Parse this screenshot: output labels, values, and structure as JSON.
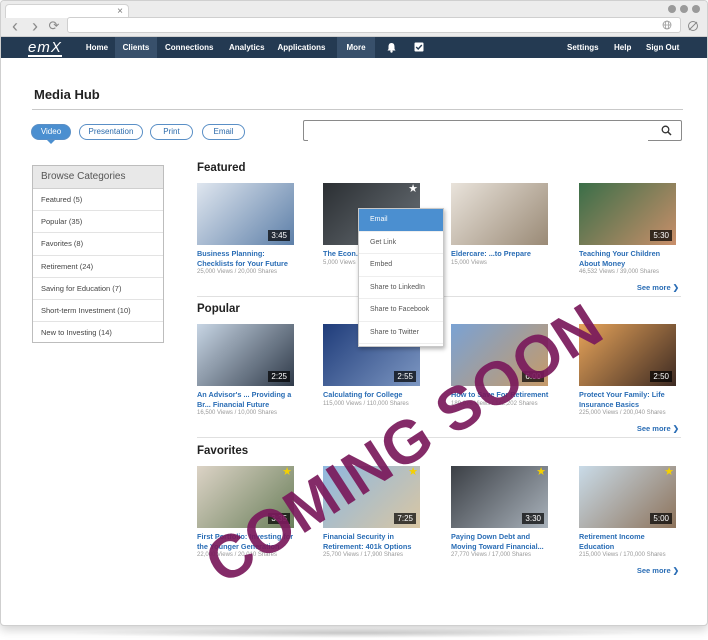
{
  "browser": {
    "tab_close": "×",
    "back_icon": "‹",
    "forward_icon": "›",
    "reload_icon": "⟳"
  },
  "topnav": {
    "logo": "emX",
    "items": [
      {
        "label": "Home",
        "active": false
      },
      {
        "label": "Clients",
        "active": true
      },
      {
        "label": "Connections",
        "active": false
      },
      {
        "label": "Analytics",
        "active": false
      },
      {
        "label": "Applications ▾",
        "active": false
      },
      {
        "label": "More ▾",
        "active": true
      }
    ],
    "right_items": [
      "Settings",
      "Help",
      "Sign Out"
    ],
    "icons": [
      "bell-icon",
      "checkbox-icon"
    ]
  },
  "page": {
    "title": "Media Hub",
    "filters": [
      "Video",
      "Presentation",
      "Print",
      "Email"
    ],
    "search_placeholder": ""
  },
  "sidebar": {
    "heading": "Browse Categories",
    "items": [
      "Featured (5)",
      "Popular (35)",
      "Favorites (8)",
      "Retirement (24)",
      "Saving for Education (7)",
      "Short-term Investment (10)",
      "New to Investing (14)"
    ]
  },
  "sections": [
    {
      "title": "Featured",
      "see_more": "See more ❯",
      "cards": [
        {
          "title": "Business Planning: Checklists for Your Future",
          "stats": "25,000 Views / 20,000 Shares",
          "duration": "3:45",
          "star": false,
          "colors": [
            "#dfe6ef",
            "#5d7fa8"
          ]
        },
        {
          "title": "The Econ... America",
          "stats": "5,000 Views",
          "duration": "",
          "star": true,
          "colors": [
            "#2b2f33",
            "#6b7278"
          ]
        },
        {
          "title": "Eldercare: ...to Prepare",
          "stats": "15,000 Views",
          "duration": "",
          "star": false,
          "colors": [
            "#e9e3db",
            "#9a8a76"
          ]
        },
        {
          "title": "Teaching Your Children About Money",
          "stats": "46,532 Views / 39,000 Shares",
          "duration": "5:30",
          "star": false,
          "colors": [
            "#3a6e48",
            "#c98f6a"
          ]
        }
      ]
    },
    {
      "title": "Popular",
      "see_more": "See more ❯",
      "cards": [
        {
          "title": "An Advisor's ... Providing a Br... Financial Future",
          "stats": "16,500 Views / 10,000 Shares",
          "duration": "2:25",
          "star": false,
          "colors": [
            "#c7d5e4",
            "#2f3a49"
          ]
        },
        {
          "title": "Calculating for College",
          "stats": "115,000 Views / 110,000 Shares",
          "duration": "2:55",
          "star": false,
          "colors": [
            "#1f3c7a",
            "#7d97c2"
          ]
        },
        {
          "title": "How to Save For Retirement",
          "stats": "189,076 Views / 142,202 Shares",
          "duration": "6:00",
          "star": false,
          "colors": [
            "#7aa2d4",
            "#c69a68"
          ]
        },
        {
          "title": "Protect Your Family: Life Insurance Basics",
          "stats": "225,000 Views / 200,040 Shares",
          "duration": "2:50",
          "star": false,
          "colors": [
            "#e7a45a",
            "#3d2a22"
          ]
        }
      ]
    },
    {
      "title": "Favorites",
      "see_more": "See more ❯",
      "cards": [
        {
          "title": "First Portfolio: Investing for the Younger Generation",
          "stats": "22,000 Views / 20,010 Shares",
          "duration": "3:35",
          "star": true,
          "colors": [
            "#dcd3c6",
            "#6a7f5a"
          ]
        },
        {
          "title": "Financial Security in Retirement: 401k Options",
          "stats": "25,700 Views / 17,900 Shares",
          "duration": "7:25",
          "star": true,
          "colors": [
            "#8fb8df",
            "#d9c6a3"
          ]
        },
        {
          "title": "Paying Down Debt and Moving Toward Financial...",
          "stats": "27,770 Views / 17,000 Shares",
          "duration": "3:30",
          "star": true,
          "colors": [
            "#3b3f45",
            "#a9b2bb"
          ]
        },
        {
          "title": "Retirement Income Education",
          "stats": "215,000 Views / 170,000 Shares",
          "duration": "5:00",
          "star": true,
          "colors": [
            "#c9dbe8",
            "#8d735b"
          ]
        }
      ]
    }
  ],
  "context_menu": {
    "items": [
      "Email",
      "Get Link",
      "Embed",
      "Share to LinkedIn",
      "Share to Facebook",
      "Share to Twitter"
    ],
    "selected": 0
  },
  "overlay": {
    "text": "COMING SOON"
  }
}
